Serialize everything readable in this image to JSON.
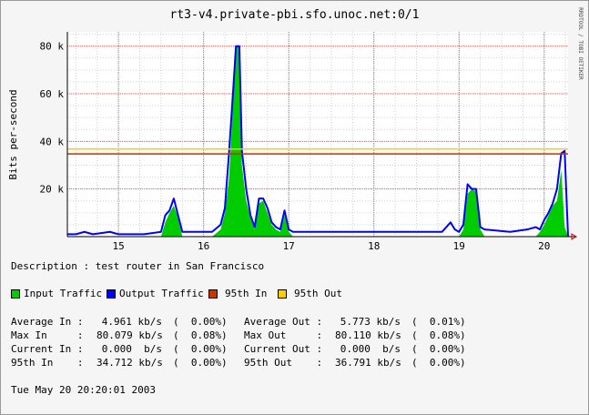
{
  "title": "rt3-v4.private-pbi.sfo.unoc.net:0/1",
  "watermark": "RRDTOOL / TOBI OETIKER",
  "description": "Description : test router in San Francisco",
  "legend": [
    {
      "label": "Input Traffic",
      "color": "#00cc00"
    },
    {
      "label": "Output Traffic",
      "color": "#0000ff"
    },
    {
      "label": "95th In",
      "color": "#cc3300"
    },
    {
      "label": "95th Out",
      "color": "#ffcc00"
    }
  ],
  "stats": [
    [
      "Average In :",
      "4.961 kb/s",
      "(  0.00%)",
      "Average Out :",
      "5.773 kb/s",
      "(  0.01%)"
    ],
    [
      "Max In     :",
      "80.079 kb/s",
      "(  0.08%)",
      "Max Out     :",
      "80.110 kb/s",
      "(  0.08%)"
    ],
    [
      "Current In :",
      "0.000  b/s",
      "(  0.00%)",
      "Current Out :",
      "0.000  b/s",
      "(  0.00%)"
    ],
    [
      "95th In    :",
      "34.712 kb/s",
      "(  0.00%)",
      "95th Out    :",
      "36.791 kb/s",
      "(  0.00%)"
    ]
  ],
  "timestamp": "Tue May 20 20:20:01 2003",
  "chart_data": {
    "type": "area",
    "title": "rt3-v4.private-pbi.sfo.unoc.net:0/1",
    "ylabel": "Bits per-second",
    "xlabel": "",
    "xlim": [
      14.4,
      20.28
    ],
    "ylim": [
      0,
      86
    ],
    "x_ticks": [
      15,
      16,
      17,
      18,
      19,
      20
    ],
    "x_tick_labels": [
      "15",
      "16",
      "17",
      "18",
      "19",
      "20"
    ],
    "y_ticks": [
      20,
      40,
      60,
      80
    ],
    "y_tick_labels": [
      "20 k",
      "40 k",
      "60 k",
      "80 k"
    ],
    "y_unit": "kb/s",
    "grid": true,
    "series": [
      {
        "name": "Input Traffic",
        "color": "#00cc00",
        "x": [
          14.4,
          15.5,
          15.55,
          15.6,
          15.65,
          15.7,
          15.75,
          16.1,
          16.2,
          16.25,
          16.3,
          16.35,
          16.38,
          16.42,
          16.45,
          16.5,
          16.55,
          16.6,
          16.65,
          16.7,
          16.75,
          16.8,
          16.85,
          16.9,
          16.95,
          17.0,
          17.05,
          19.0,
          19.05,
          19.1,
          19.15,
          19.2,
          19.25,
          19.3,
          19.9,
          19.95,
          20.0,
          20.05,
          20.1,
          20.15,
          20.2,
          20.24,
          20.28
        ],
        "y": [
          0,
          0,
          6,
          10,
          13,
          8,
          0,
          0,
          3,
          10,
          25,
          60,
          80,
          80,
          30,
          15,
          8,
          3,
          14,
          15,
          10,
          5,
          3,
          2,
          9,
          2,
          0,
          0,
          3,
          18,
          20,
          19,
          3,
          0,
          0,
          2,
          5,
          9,
          13,
          15,
          28,
          4,
          0
        ]
      },
      {
        "name": "Output Traffic",
        "color": "#0000ff",
        "x": [
          14.4,
          14.5,
          14.6,
          14.7,
          14.9,
          15.0,
          15.3,
          15.5,
          15.55,
          15.6,
          15.65,
          15.7,
          15.75,
          16.1,
          16.2,
          16.25,
          16.3,
          16.35,
          16.38,
          16.42,
          16.45,
          16.5,
          16.55,
          16.6,
          16.65,
          16.7,
          16.75,
          16.8,
          16.85,
          16.9,
          16.95,
          17.0,
          17.05,
          17.3,
          17.6,
          18.0,
          18.5,
          18.8,
          18.9,
          18.95,
          19.0,
          19.05,
          19.1,
          19.15,
          19.2,
          19.25,
          19.3,
          19.6,
          19.8,
          19.9,
          19.95,
          20.0,
          20.05,
          20.1,
          20.15,
          20.2,
          20.24,
          20.28
        ],
        "y": [
          1,
          1,
          2,
          1,
          2,
          1,
          1,
          2,
          9,
          11,
          16,
          9,
          2,
          2,
          5,
          12,
          36,
          63,
          80,
          80,
          36,
          20,
          9,
          4,
          16,
          16,
          12,
          6,
          4,
          3,
          11,
          3,
          2,
          2,
          2,
          2,
          2,
          2,
          6,
          3,
          2,
          5,
          22,
          20,
          20,
          4,
          3,
          2,
          3,
          4,
          3,
          7,
          10,
          14,
          20,
          35,
          36,
          0
        ]
      },
      {
        "name": "95th In",
        "color": "#cc3300",
        "x": [
          14.4,
          20.28
        ],
        "y": [
          34.712,
          34.712
        ]
      },
      {
        "name": "95th Out",
        "color": "#ffcc00",
        "x": [
          14.4,
          20.28
        ],
        "y": [
          36.791,
          36.791
        ]
      }
    ]
  }
}
